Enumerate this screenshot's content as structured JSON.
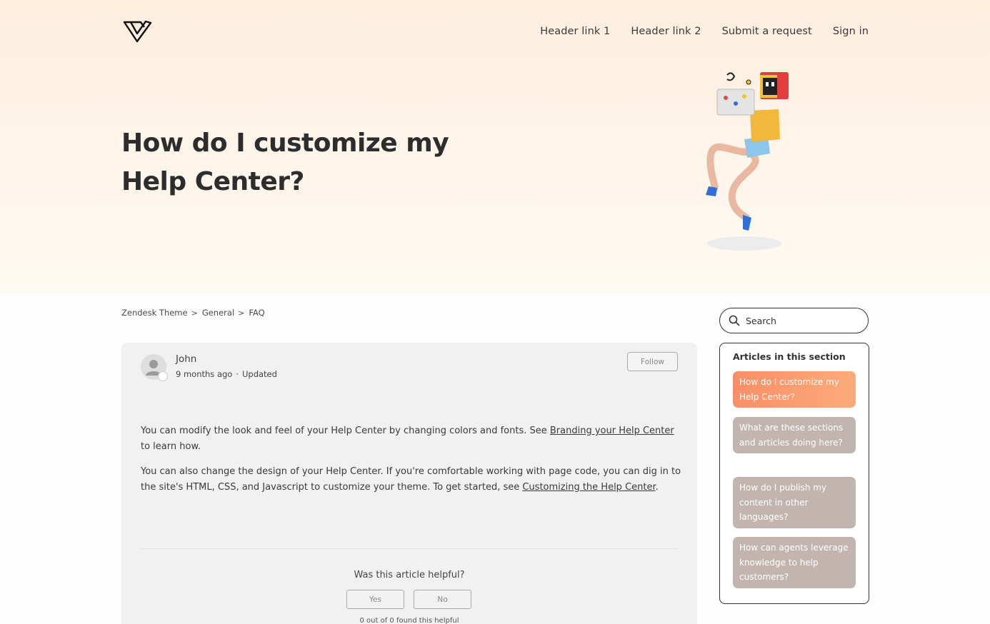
{
  "header": {
    "nav": [
      "Header link 1",
      "Header link 2",
      "Submit a request",
      "Sign in"
    ]
  },
  "hero": {
    "title": "How do I customize my Help Center?"
  },
  "breadcrumbs": [
    "Zendesk Theme",
    "General",
    "FAQ"
  ],
  "search": {
    "placeholder": "Search"
  },
  "article": {
    "author": "John",
    "time": "9 months ago",
    "dot": "·",
    "updated": "Updated",
    "follow_label": "Follow",
    "paragraph1_pre": "You can modify the look and feel of your Help Center by changing colors and fonts. See ",
    "paragraph1_link": "Branding your Help Center",
    "paragraph1_post": " to learn how.",
    "paragraph2_pre": "You can also change the design of your Help Center. If you're comfortable working with page code, you can dig in to the site's HTML, CSS, and Javascript to customize your theme. To get started, see ",
    "paragraph2_link": "Customizing the Help Center",
    "paragraph2_post": ".",
    "helpful_question": "Was this article helpful?",
    "yes_label": "Yes",
    "no_label": "No",
    "found_helpful": "0 out of 0 found this helpful"
  },
  "sidebar": {
    "title": "Articles in this section",
    "items": [
      "How do I customize my Help Center?",
      "What are these sections and articles doing here?",
      "How do I publish my content in other languages?",
      "How can agents leverage knowledge to help customers?"
    ],
    "active_index": 0
  },
  "colors": {
    "active_item": "#f98f67",
    "inactive_item": "#c2b5b0",
    "hero_bg": "#fdeede"
  },
  "icons": [
    "brand-logo-icon",
    "search-icon",
    "user-avatar-icon",
    "chevron-right-icon"
  ]
}
